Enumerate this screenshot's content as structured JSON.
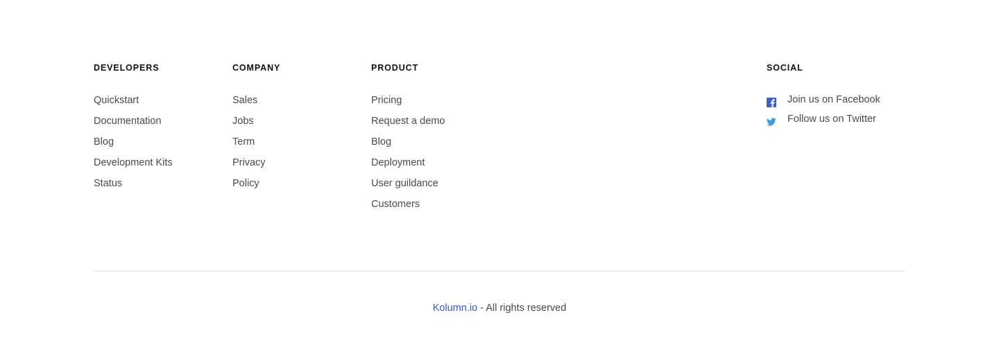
{
  "footer": {
    "developers": {
      "title": "DEVELOPERS",
      "links": [
        "Quickstart",
        "Documentation",
        "Blog",
        "Development Kits",
        "Status"
      ]
    },
    "company": {
      "title": "COMPANY",
      "links": [
        "Sales",
        "Jobs",
        "Term",
        "Privacy",
        "Policy"
      ]
    },
    "product": {
      "title": "PRODUCT",
      "links": [
        "Pricing",
        "Request a demo",
        "Blog",
        "Deployment",
        "User guildance",
        "Customers"
      ]
    },
    "social": {
      "title": "SOCIAL",
      "links": [
        {
          "label": "Join us on Facebook",
          "icon": "facebook-icon",
          "color": "#3a5fc7"
        },
        {
          "label": "Follow us on Twitter",
          "icon": "twitter-icon",
          "color": "#3a9fe0"
        }
      ]
    },
    "copyright": {
      "brand": "Kolumn.io",
      "text": " - All rights reserved",
      "brand_color": "#2f5bd6"
    }
  }
}
